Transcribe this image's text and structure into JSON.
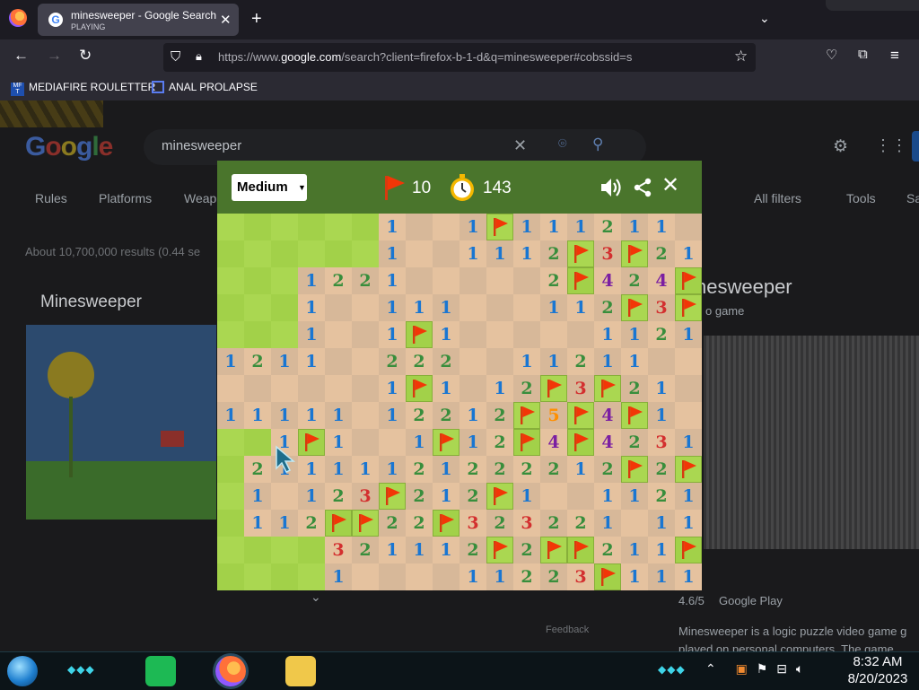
{
  "browser": {
    "tab": {
      "favicon": "G",
      "title": "minesweeper - Google Search",
      "subtitle": "PLAYING"
    },
    "url": {
      "prefix": "https://www.",
      "domain": "google.com",
      "rest": "/search?client=firefox-b-1-d&q=minesweeper#cobssid=s"
    },
    "bookmarks": [
      {
        "label": "MEDIAFIRE ROULETTER"
      },
      {
        "label": "ANAL PROLAPSE"
      }
    ]
  },
  "background_page": {
    "logo": "Google",
    "query": "minesweeper",
    "tabs": [
      "Rules",
      "Platforms",
      "Weap"
    ],
    "results_count": "About 10,700,000 results (0.44 se",
    "left_title": "Minesweeper",
    "right_filters": [
      "All filters",
      "Tools",
      "Sa"
    ],
    "kp_title": "nesweeper",
    "kp_subtitle": "o game",
    "rating": "4.6/5",
    "rating_source": "Google Play",
    "description": "Minesweeper is a logic puzzle video game g",
    "description2": "played on personal computers. The game",
    "feedback": "Feedback"
  },
  "game": {
    "difficulty": "Medium",
    "flags_remaining": "10",
    "timer": "143",
    "number_colors": {
      "1": "#1976d2",
      "2": "#388e3c",
      "3": "#d32f2f",
      "4": "#7b1fa2",
      "5": "#ff8f00"
    },
    "board": [
      [
        "H",
        "H",
        "H",
        "H",
        "H",
        "H",
        "1",
        "E",
        "E",
        "1",
        "F",
        "1",
        "1",
        "1",
        "2",
        "1",
        "1",
        "E"
      ],
      [
        "H",
        "H",
        "H",
        "H",
        "H",
        "H",
        "1",
        "E",
        "E",
        "1",
        "1",
        "1",
        "2",
        "F",
        "3",
        "F",
        "2",
        "1"
      ],
      [
        "H",
        "H",
        "H",
        "1",
        "2",
        "2",
        "1",
        "E",
        "E",
        "E",
        "E",
        "E",
        "2",
        "F",
        "4",
        "2",
        "4",
        "F"
      ],
      [
        "H",
        "H",
        "H",
        "1",
        "E",
        "E",
        "1",
        "1",
        "1",
        "E",
        "E",
        "E",
        "1",
        "1",
        "2",
        "F",
        "3",
        "F"
      ],
      [
        "H",
        "H",
        "H",
        "1",
        "E",
        "E",
        "1",
        "F",
        "1",
        "E",
        "E",
        "E",
        "E",
        "E",
        "1",
        "1",
        "2",
        "1"
      ],
      [
        "1",
        "2",
        "1",
        "1",
        "E",
        "E",
        "2",
        "2",
        "2",
        "E",
        "E",
        "1",
        "1",
        "2",
        "1",
        "1",
        "E",
        "E"
      ],
      [
        "E",
        "E",
        "E",
        "E",
        "E",
        "E",
        "1",
        "F",
        "1",
        "E",
        "1",
        "2",
        "F",
        "3",
        "F",
        "2",
        "1",
        "E"
      ],
      [
        "1",
        "1",
        "1",
        "1",
        "1",
        "E",
        "1",
        "2",
        "2",
        "1",
        "2",
        "F",
        "5",
        "F",
        "4",
        "F",
        "1",
        "E"
      ],
      [
        "H",
        "H",
        "1",
        "F",
        "1",
        "E",
        "E",
        "1",
        "F",
        "1",
        "2",
        "F",
        "4",
        "F",
        "4",
        "2",
        "3",
        "1"
      ],
      [
        "H",
        "2",
        "1",
        "1",
        "1",
        "1",
        "1",
        "2",
        "1",
        "2",
        "2",
        "2",
        "2",
        "1",
        "2",
        "F",
        "2",
        "F"
      ],
      [
        "H",
        "1",
        "E",
        "1",
        "2",
        "3",
        "F",
        "2",
        "1",
        "2",
        "F",
        "1",
        "E",
        "E",
        "1",
        "1",
        "2",
        "1"
      ],
      [
        "H",
        "1",
        "1",
        "2",
        "F",
        "F",
        "2",
        "2",
        "F",
        "3",
        "2",
        "3",
        "2",
        "2",
        "1",
        "E",
        "1",
        "1"
      ],
      [
        "H",
        "H",
        "H",
        "H",
        "3",
        "2",
        "1",
        "1",
        "1",
        "2",
        "F",
        "2",
        "F",
        "F",
        "2",
        "1",
        "1",
        "F"
      ],
      [
        "H",
        "H",
        "H",
        "H",
        "1",
        "E",
        "E",
        "E",
        "E",
        "1",
        "1",
        "2",
        "2",
        "3",
        "F",
        "1",
        "1",
        "1"
      ]
    ]
  },
  "taskbar": {
    "time": "8:32 AM",
    "date": "8/20/2023",
    "tray_icons": [
      "network-icon",
      "volume-icon"
    ]
  }
}
